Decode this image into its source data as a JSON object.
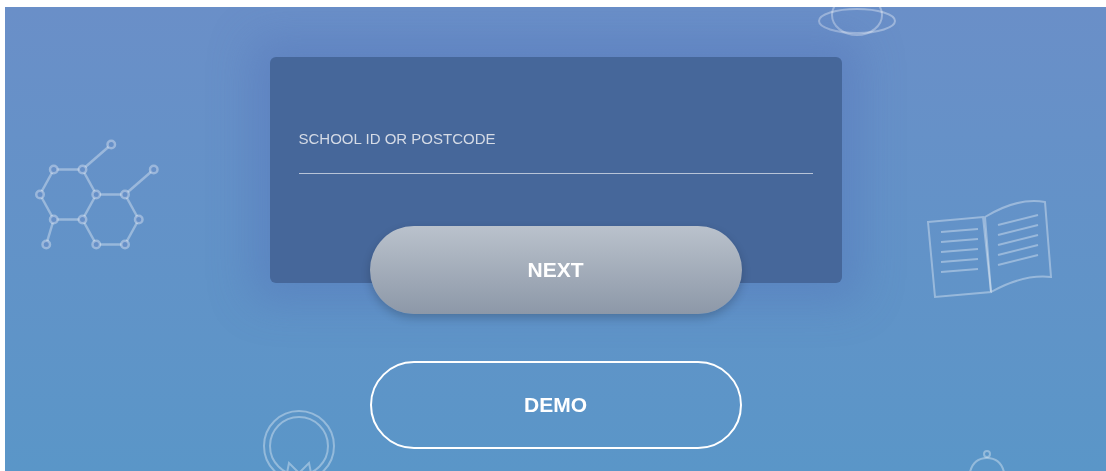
{
  "login_card": {
    "field": {
      "placeholder": "SCHOOL ID OR POSTCODE"
    }
  },
  "buttons": [
    {
      "label": "NEXT",
      "kind": "filled"
    },
    {
      "label": "DEMO",
      "kind": "outline"
    }
  ]
}
